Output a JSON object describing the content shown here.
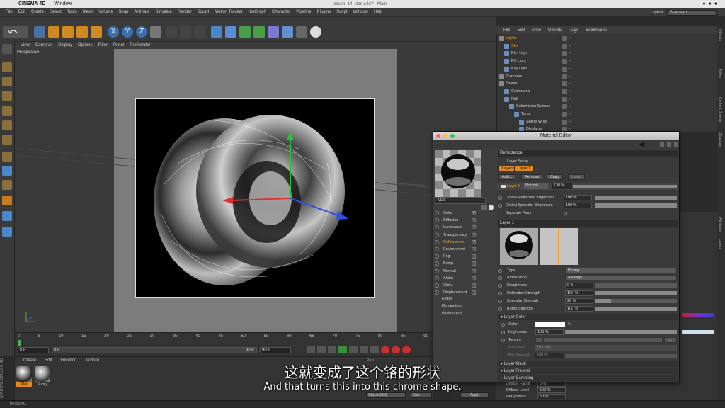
{
  "mac_menu": {
    "app": "CINEMA 4D",
    "window": "Window",
    "doc_title": "lesson_14_start.c4d * - Main"
  },
  "app_menu": [
    "File",
    "Edit",
    "Create",
    "Select",
    "Tools",
    "Mesh",
    "Volume",
    "Snap",
    "Animate",
    "Simulate",
    "Render",
    "Sculpt",
    "Motion Tracker",
    "MoGraph",
    "Character",
    "Pipeline",
    "Plugins",
    "Script",
    "Window",
    "Help"
  ],
  "layout": {
    "label": "Layout:",
    "value": "Standard"
  },
  "toolbar": {
    "axis_x": "X",
    "axis_y": "Y",
    "axis_z": "Z"
  },
  "viewport": {
    "menu": [
      "View",
      "Cameras",
      "Display",
      "Options",
      "Filter",
      "Panel",
      "ProRender"
    ],
    "label": "Perspective"
  },
  "timeline": {
    "ticks": [
      "0",
      "5",
      "10",
      "15",
      "20",
      "25",
      "30",
      "35",
      "40",
      "45",
      "50",
      "55",
      "60",
      "65",
      "70",
      "75",
      "80",
      "85",
      "90"
    ],
    "start": "0 F",
    "current": "0 F",
    "range_end": "90 F",
    "end": "90 F"
  },
  "material_manager": {
    "menu": [
      "Create",
      "Edit",
      "Function",
      "Texture"
    ],
    "materials": [
      "Mat",
      "Sunny"
    ]
  },
  "maxon_logo": "MAXON CINEMA 4D",
  "status": "00:00:01",
  "object_manager": {
    "menu": [
      "File",
      "Edit",
      "View",
      "Objects",
      "Tags",
      "Bookmarks"
    ],
    "objects": [
      {
        "name": "Lights",
        "indent": 0,
        "color": "#e0a030"
      },
      {
        "name": "Sky",
        "indent": 1,
        "color": "#e0a030"
      },
      {
        "name": "Rim Light",
        "indent": 1,
        "color": "#cccccc"
      },
      {
        "name": "Fill Light",
        "indent": 1,
        "color": "#cccccc"
      },
      {
        "name": "Key Light",
        "indent": 1,
        "color": "#cccccc"
      },
      {
        "name": "Cameras",
        "indent": 0,
        "color": "#cccccc"
      },
      {
        "name": "Scene",
        "indent": 0,
        "color": "#cccccc"
      },
      {
        "name": "Cyclorama",
        "indent": 1,
        "color": "#cccccc"
      },
      {
        "name": "Null",
        "indent": 1,
        "color": "#cccccc"
      },
      {
        "name": "Subdivision Surface",
        "indent": 2,
        "color": "#cccccc"
      },
      {
        "name": "Torus",
        "indent": 3,
        "color": "#cccccc"
      },
      {
        "name": "Spline Wrap",
        "indent": 4,
        "color": "#cccccc"
      },
      {
        "name": "Displacer",
        "indent": 4,
        "color": "#cccccc"
      }
    ]
  },
  "right_tabs": [
    "Objects",
    "Takes",
    "Content Browser",
    "Structure",
    "Attributes",
    "Layers"
  ],
  "material_editor": {
    "title": "Material Editor",
    "material_name": "Mat",
    "channels": [
      {
        "name": "Color",
        "checked": true,
        "active": false
      },
      {
        "name": "Diffusion",
        "checked": false,
        "active": false
      },
      {
        "name": "Luminance",
        "checked": false,
        "active": false
      },
      {
        "name": "Transparency",
        "checked": false,
        "active": false
      },
      {
        "name": "Reflectance",
        "checked": true,
        "active": true
      },
      {
        "name": "Environment",
        "checked": false,
        "active": false
      },
      {
        "name": "Fog",
        "checked": false,
        "active": false
      },
      {
        "name": "Bump",
        "checked": false,
        "active": false
      },
      {
        "name": "Normal",
        "checked": false,
        "active": false
      },
      {
        "name": "Alpha",
        "checked": false,
        "active": false
      },
      {
        "name": "Glow",
        "checked": false,
        "active": false
      },
      {
        "name": "Displacement",
        "checked": false,
        "active": false
      }
    ],
    "extra_items": [
      "Editor",
      "Illumination",
      "Assignment"
    ],
    "reflectance": {
      "section": "Reflectance",
      "layer_setup": "Layer Setup",
      "tabs": [
        "Layers",
        "Layer 1"
      ],
      "buttons": [
        "Add...",
        "Remove",
        "Copy",
        "Paste"
      ],
      "layer_row": {
        "name": "Layer 1",
        "mode": "Normal",
        "opacity": "100 %"
      },
      "global_reflection": {
        "label": "Global Reflection Brightness",
        "value": "100 %",
        "fill": 1.0
      },
      "global_specular": {
        "label": "Global Specular Brightness",
        "value": "100 %",
        "fill": 1.0
      },
      "separate_pass": "Separate Pass"
    },
    "layer1": {
      "section": "Layer 1",
      "type": {
        "label": "Type",
        "value": "Phong"
      },
      "attenuation": {
        "label": "Attenuation",
        "value": "Average"
      },
      "roughness": {
        "label": "Roughness",
        "value": "0 %",
        "fill": 0.0
      },
      "reflection_strength": {
        "label": "Reflection Strength",
        "value": "100 %",
        "fill": 1.0
      },
      "specular_strength": {
        "label": "Specular Strength",
        "value": "20 %",
        "fill": 0.2
      },
      "bump_strength": {
        "label": "Bump Strength",
        "value": "100 %",
        "fill": 1.0
      },
      "layer_color": "Layer Color",
      "color_label": "Color",
      "brightness": {
        "label": "Brightness",
        "value": "100 %",
        "fill": 1.0
      },
      "texture_label": "Texture",
      "mix_mode": {
        "label": "Mix Mode",
        "value": "Normal"
      },
      "mix_strength": {
        "label": "Mix Strength",
        "value": "100 %"
      },
      "folds": [
        "Layer Mask",
        "Layer Fresnel",
        "Layer Sampling"
      ]
    }
  },
  "attr_rows": [
    {
      "label": "Diffuse Falloff",
      "value": "0 %"
    },
    {
      "label": "Diffuse Level",
      "value": "100 %"
    },
    {
      "label": "Roughness",
      "value": "50 %"
    }
  ],
  "coord": {
    "posi_label": "Posi",
    "mode": "Object (Rel)",
    "size": "Size",
    "apply": "Apply"
  },
  "subtitles": {
    "zh": "这就变成了这个铬的形状",
    "en": "And that turns this into this chrome shape,"
  },
  "colors": {
    "accent": "#e08a1e",
    "bg": "#2b2b2b",
    "panel": "#3a3a3a"
  }
}
